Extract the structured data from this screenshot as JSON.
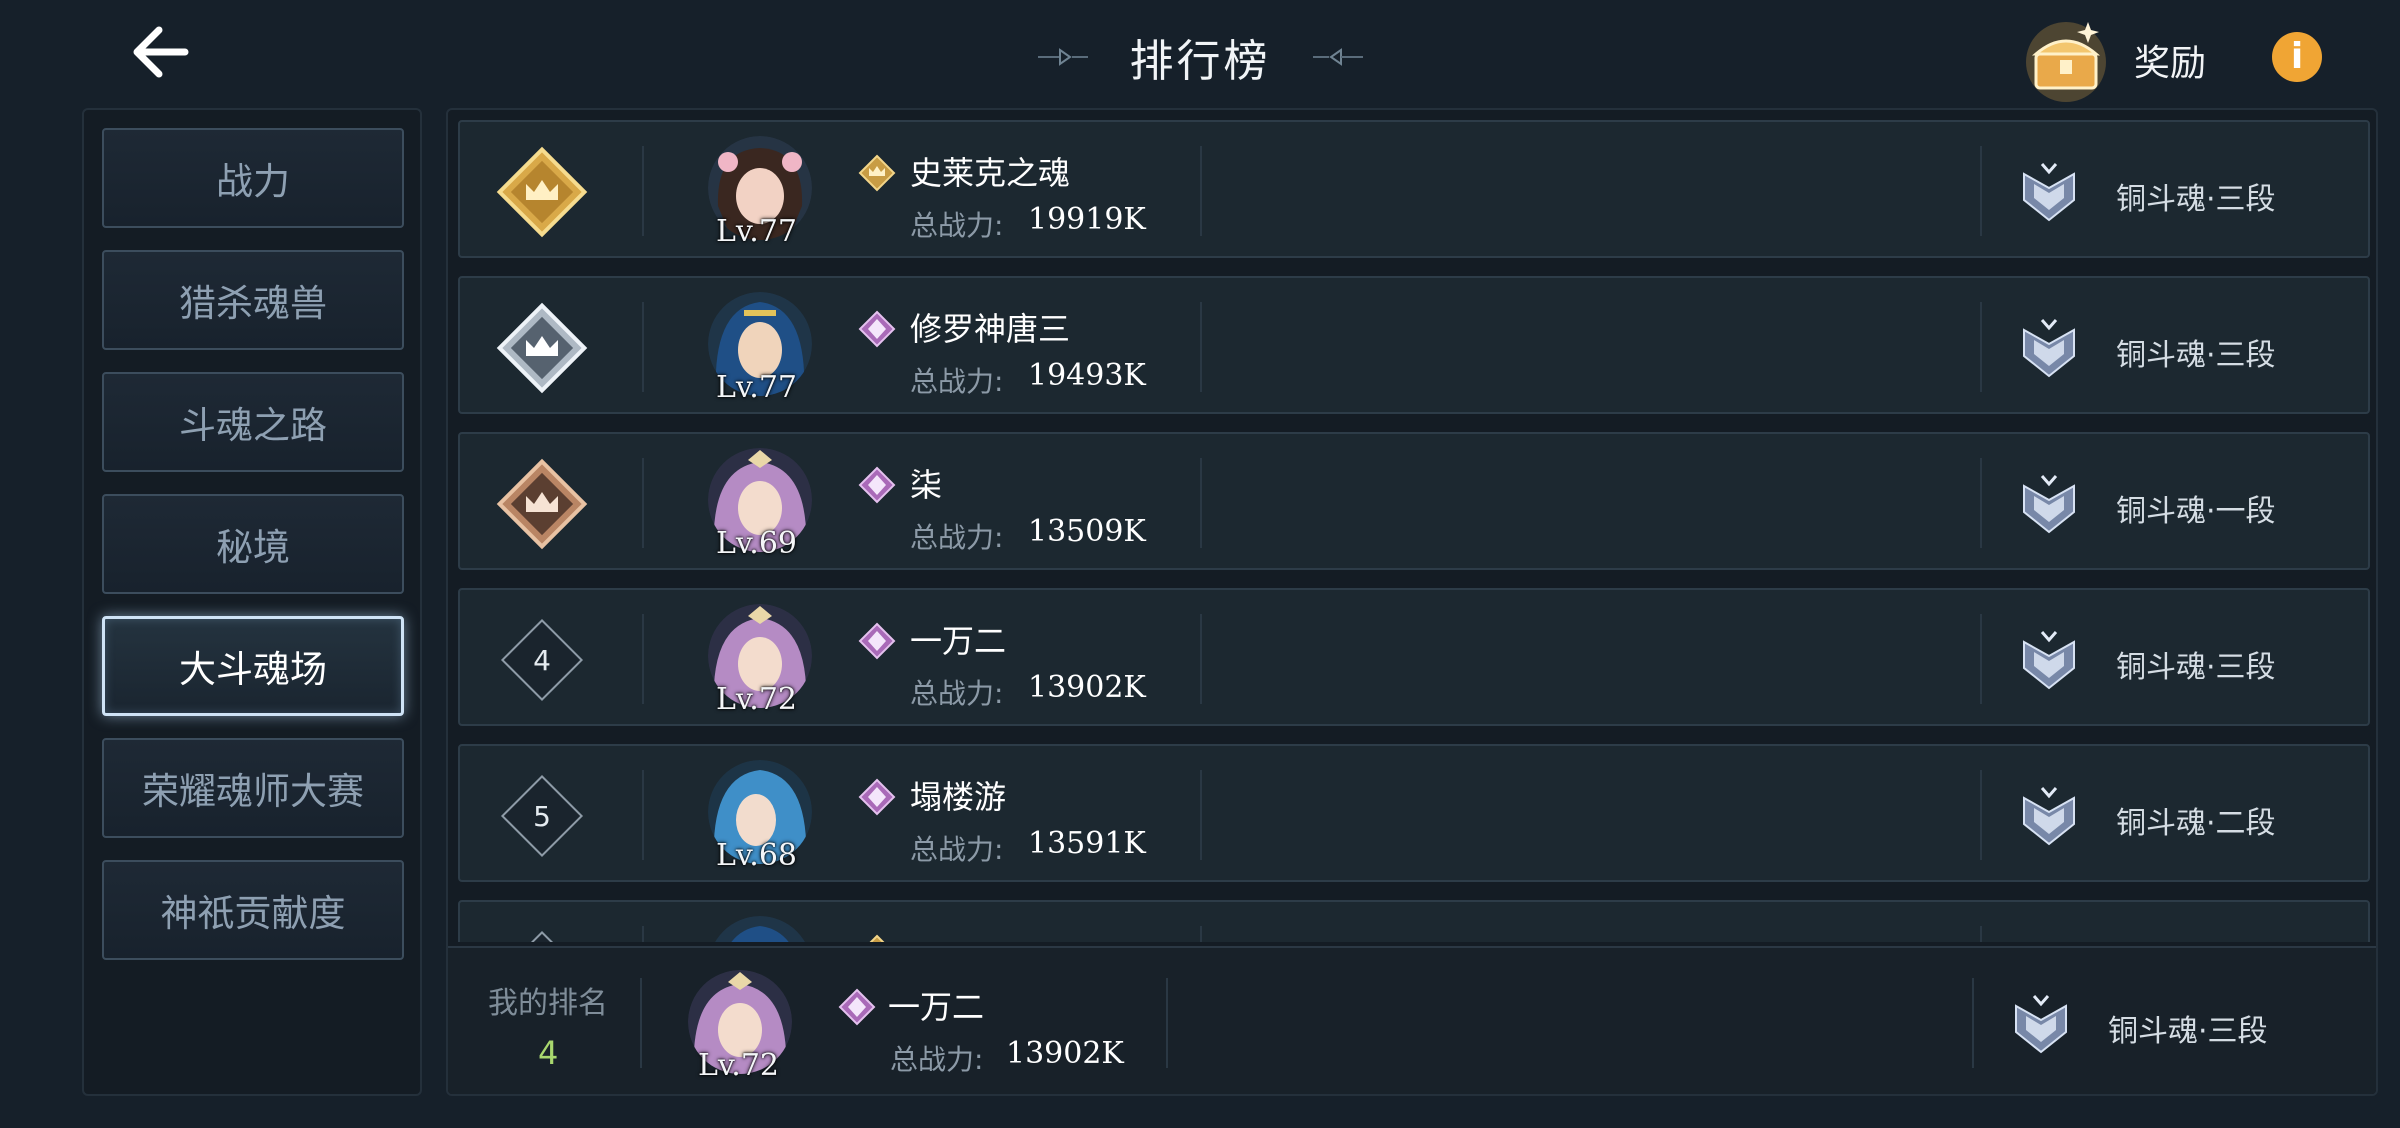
{
  "header": {
    "title": "排行榜",
    "reward_label": "奖励",
    "info_glyph": "i"
  },
  "sidebar": {
    "items": [
      {
        "label": "战力",
        "active": false
      },
      {
        "label": "猎杀魂兽",
        "active": false
      },
      {
        "label": "斗魂之路",
        "active": false
      },
      {
        "label": "秘境",
        "active": false
      },
      {
        "label": "大斗魂场",
        "active": true
      },
      {
        "label": "荣耀魂师大赛",
        "active": false
      },
      {
        "label": "神祇贡献度",
        "active": false
      }
    ]
  },
  "leaderboard": {
    "power_label": "总战力:",
    "rows": [
      {
        "rank": "1",
        "rank_style": "gold-crown",
        "level": "Lv.77",
        "name": "史莱克之魂",
        "power": "19919K",
        "tier": "铜斗魂·三段",
        "avatar": "dark-hair-girl"
      },
      {
        "rank": "2",
        "rank_style": "silver-crown",
        "level": "Lv.77",
        "name": "修罗神唐三",
        "power": "19493K",
        "tier": "铜斗魂·三段",
        "avatar": "blue-hair-warrior"
      },
      {
        "rank": "3",
        "rank_style": "bronze-crown",
        "level": "Lv.69",
        "name": "柒",
        "power": "13509K",
        "tier": "铜斗魂·一段",
        "avatar": "purple-hair-girl"
      },
      {
        "rank": "4",
        "rank_style": "number",
        "level": "Lv.72",
        "name": "一万二",
        "power": "13902K",
        "tier": "铜斗魂·三段",
        "avatar": "purple-hair-girl"
      },
      {
        "rank": "5",
        "rank_style": "number",
        "level": "Lv.68",
        "name": "塌楼游",
        "power": "13591K",
        "tier": "铜斗魂·二段",
        "avatar": "blue-hair-girl"
      },
      {
        "rank": "",
        "rank_style": "number",
        "level": "",
        "name": "",
        "power": "",
        "tier": "",
        "avatar": "blue-hair-warrior"
      }
    ]
  },
  "my_rank": {
    "label": "我的排名",
    "rank": "4",
    "level": "Lv.72",
    "name": "一万二",
    "power_label": "总战力:",
    "power": "13902K",
    "tier": "铜斗魂·三段"
  },
  "colors": {
    "background": "#16202a",
    "gold": "#e6b857",
    "accent_green": "#a8d76e",
    "info_orange": "#f0a534"
  }
}
